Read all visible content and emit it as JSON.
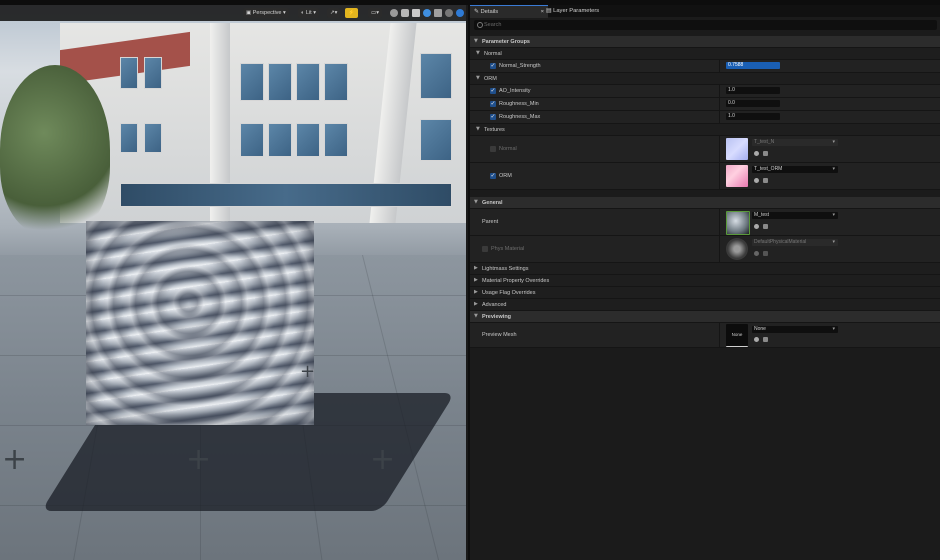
{
  "viewport": {
    "perspective_label": "Perspective",
    "lit_label": "Lit"
  },
  "tabs": {
    "details": "Details",
    "layer_parameters": "Layer Parameters"
  },
  "search": {
    "placeholder": "Search"
  },
  "sections": {
    "parameter_groups": "Parameter Groups",
    "normal": "Normal",
    "orm": "ORM",
    "textures": "Textures",
    "general": "General",
    "lightmass": "Lightmass Settings",
    "mpo": "Material Property Overrides",
    "usage_flag": "Usage Flag Overrides",
    "advanced": "Advanced",
    "previewing": "Previewing"
  },
  "params": {
    "normal_strength": {
      "label": "Normal_Strength",
      "value": "0.7588"
    },
    "ao_intensity": {
      "label": "AO_Intensity",
      "value": "1.0"
    },
    "roughness_min": {
      "label": "Roughness_Min",
      "value": "0.0"
    },
    "roughness_max": {
      "label": "Roughness_Max",
      "value": "1.0"
    }
  },
  "textures": {
    "normal": {
      "label": "Normal",
      "asset": "T_test_N"
    },
    "orm": {
      "label": "ORM",
      "asset": "T_test_ORM"
    }
  },
  "general": {
    "parent": {
      "label": "Parent",
      "asset": "M_test"
    },
    "phys_material": {
      "label": "Phys Material",
      "asset": "DefaultPhysicalMaterial"
    }
  },
  "preview": {
    "label": "Preview Mesh",
    "thumb_text": "None",
    "asset": "None"
  },
  "colors": {
    "accent": "#1a5fb4",
    "checkbox": "#1f4f8c",
    "panel_bg": "#1b1b1b"
  }
}
